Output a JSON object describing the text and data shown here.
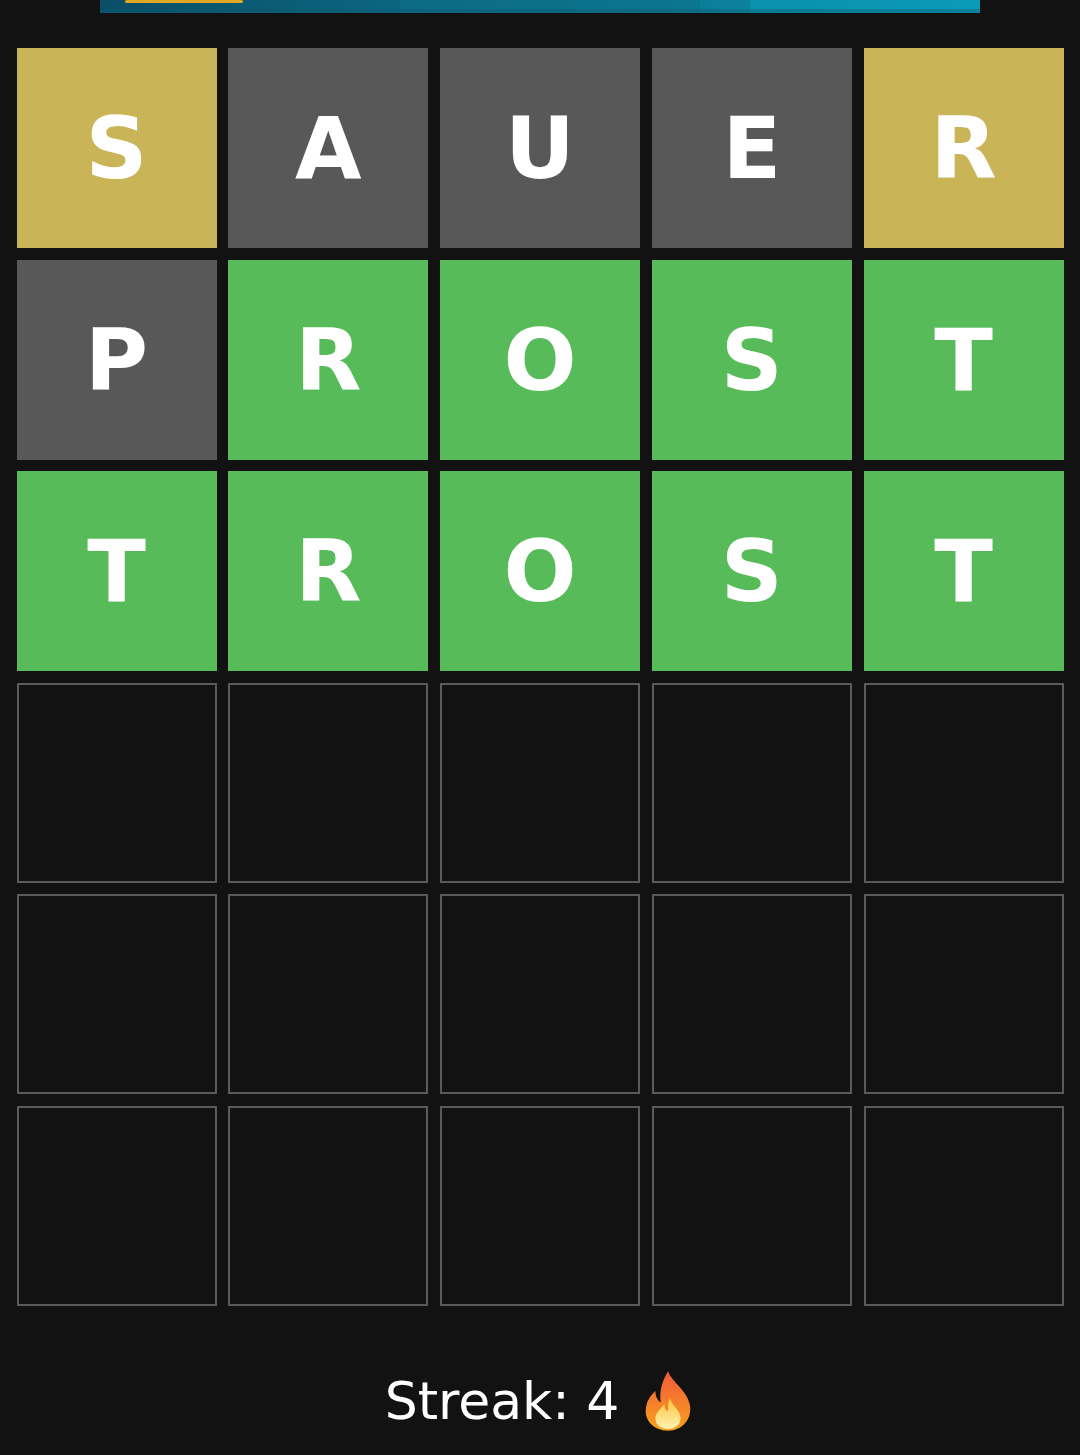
{
  "board": [
    {
      "tiles": [
        {
          "letter": "S",
          "kind": "present"
        },
        {
          "letter": "A",
          "kind": "absent"
        },
        {
          "letter": "U",
          "kind": "absent"
        },
        {
          "letter": "E",
          "kind": "absent"
        },
        {
          "letter": "R",
          "kind": "present"
        }
      ]
    },
    {
      "tiles": [
        {
          "letter": "P",
          "kind": "absent"
        },
        {
          "letter": "R",
          "kind": "correct"
        },
        {
          "letter": "O",
          "kind": "correct"
        },
        {
          "letter": "S",
          "kind": "correct"
        },
        {
          "letter": "T",
          "kind": "correct"
        }
      ]
    },
    {
      "tiles": [
        {
          "letter": "T",
          "kind": "correct"
        },
        {
          "letter": "R",
          "kind": "correct"
        },
        {
          "letter": "O",
          "kind": "correct"
        },
        {
          "letter": "S",
          "kind": "correct"
        },
        {
          "letter": "T",
          "kind": "correct"
        }
      ]
    },
    {
      "tiles": [
        {
          "kind": "empty"
        },
        {
          "kind": "empty"
        },
        {
          "kind": "empty"
        },
        {
          "kind": "empty"
        },
        {
          "kind": "empty"
        }
      ]
    },
    {
      "tiles": [
        {
          "kind": "empty"
        },
        {
          "kind": "empty"
        },
        {
          "kind": "empty"
        },
        {
          "kind": "empty"
        },
        {
          "kind": "empty"
        }
      ]
    },
    {
      "tiles": [
        {
          "kind": "empty"
        },
        {
          "kind": "empty"
        },
        {
          "kind": "empty"
        },
        {
          "kind": "empty"
        },
        {
          "kind": "empty"
        }
      ]
    }
  ],
  "streak": {
    "label": "Streak: 4"
  }
}
